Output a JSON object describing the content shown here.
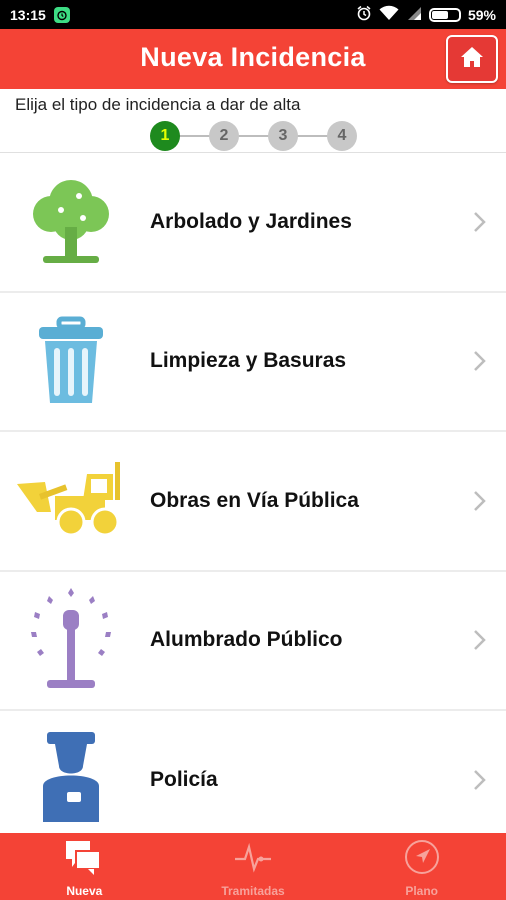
{
  "status_bar": {
    "time": "13:15",
    "battery": "59%",
    "battery_level": 0.59
  },
  "app_bar": {
    "title": "Nueva Incidencia",
    "home_icon": "home-icon"
  },
  "subtitle": "Elija el tipo de incidencia a dar de alta",
  "steps": {
    "items": [
      "1",
      "2",
      "3",
      "4"
    ],
    "current": 1
  },
  "categories": [
    {
      "label": "Arbolado y Jardines",
      "icon": "tree-icon"
    },
    {
      "label": "Limpieza y Basuras",
      "icon": "trash-bin-icon"
    },
    {
      "label": "Obras en Vía Pública",
      "icon": "bulldozer-icon"
    },
    {
      "label": "Alumbrado Público",
      "icon": "streetlight-icon"
    },
    {
      "label": "Policía",
      "icon": "police-icon"
    }
  ],
  "bottom_nav": [
    {
      "label": "Nueva",
      "icon": "chat-icon",
      "active": true
    },
    {
      "label": "Tramitadas",
      "icon": "pulse-icon",
      "active": false
    },
    {
      "label": "Plano",
      "icon": "navigation-icon",
      "active": false
    }
  ],
  "colors": {
    "primary": "#f44336",
    "step_active": "#1e8a1e",
    "step_inactive": "#c8c8c8"
  }
}
